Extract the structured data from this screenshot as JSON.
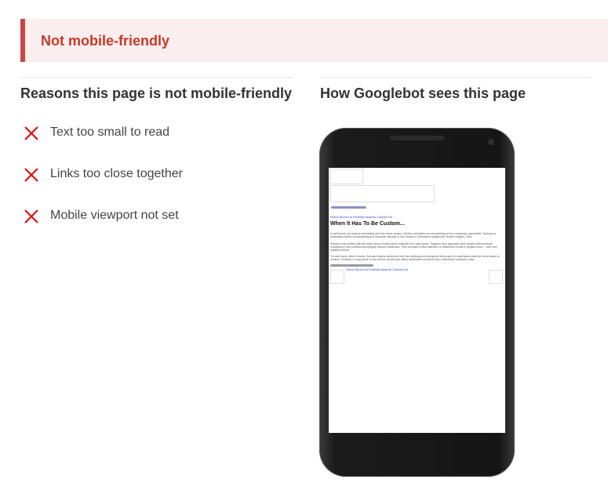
{
  "banner": {
    "title": "Not mobile-friendly"
  },
  "reasons": {
    "heading": "Reasons this page is not mobile-friendly",
    "items": [
      {
        "label": "Text too small to read",
        "icon": "x-icon"
      },
      {
        "label": "Links too close together",
        "icon": "x-icon"
      },
      {
        "label": "Mobile viewport not set",
        "icon": "x-icon"
      }
    ]
  },
  "preview": {
    "heading": "How Googlebot sees this page",
    "screen": {
      "nav_links": "Home About Us Portfolio Awards Contact Us",
      "page_heading": "When It Has To Be Custom...",
      "paragraphs": [
        "is well known for custom remodeling and fine home repairs. Kitchen and bathroom remodeling are the company's specialties. Schwarz is particularly skilled at maintaining the historical integrity of fine homes in Cleveland Heights and Shaker Heights, Ohio.",
        "Schwarz has worked with the same team of meticulous craftsmen for many years. Together they approach each project with technical competency and professional integrity that are trademark. They all share a keen attention to detail that results in elegant work — and very satisfied clients.",
        "To meet every client's needs, Schwarz listens carefully at the first meeting and throughout the project to understand what the client wants to achieve. Schwarz is responsive to the client's worries and offers achievable solutions when unforeseen obstacles arise."
      ],
      "footer_nav": "Home About Us Portfolio Awards Contact Us"
    }
  },
  "colors": {
    "accent": "#c53929",
    "banner_bg": "#fbeeee",
    "x_icon": "#dd1111"
  }
}
